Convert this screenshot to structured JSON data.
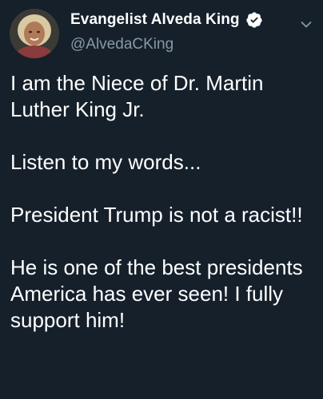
{
  "header": {
    "display_name": "Evangelist Alveda King",
    "handle": "@AlvedaCKing",
    "verified_icon": "verified-badge-icon",
    "menu_icon": "chevron-down-icon"
  },
  "tweet": {
    "paragraphs": [
      "I am the Niece of Dr. Martin Luther King Jr.",
      "Listen to my words...",
      "President Trump is not a racist!!",
      "He is one of the best presidents America has ever seen! I fully support him!"
    ]
  },
  "colors": {
    "background": "#15202b",
    "text": "#ffffff",
    "muted": "#8899a6"
  }
}
